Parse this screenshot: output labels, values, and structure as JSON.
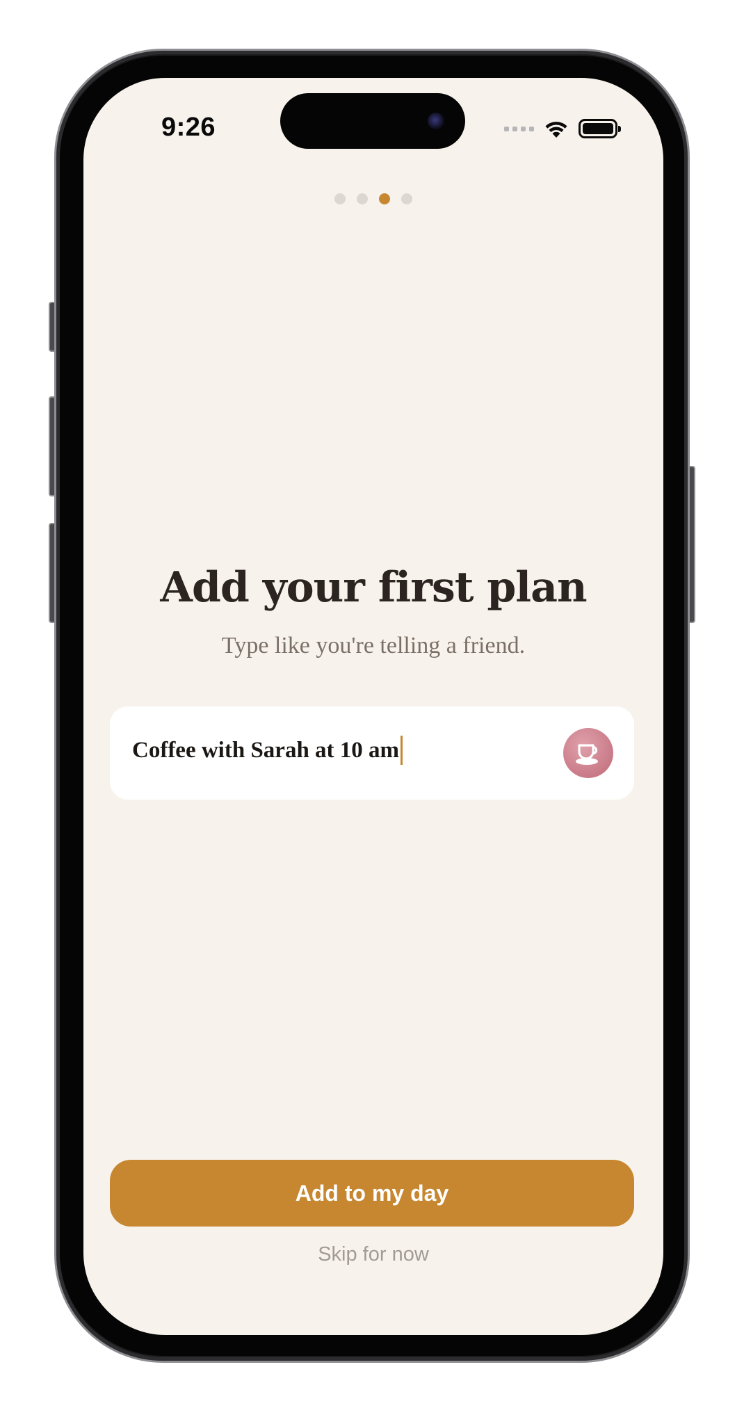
{
  "status_bar": {
    "time": "9:26",
    "icons": [
      "cellular-signal-icon",
      "wifi-icon",
      "battery-icon"
    ]
  },
  "pager": {
    "total": 4,
    "active_index": 2
  },
  "onboarding": {
    "title": "Add your first plan",
    "subtitle": "Type like you're telling a friend.",
    "plan_input": {
      "value": "Coffee with Sarah at 10 am",
      "icon": "coffee-cup-icon"
    },
    "primary_button_label": "Add to my day",
    "skip_label": "Skip for now"
  },
  "colors": {
    "background": "#f7f3ec",
    "accent": "#c78731",
    "title_text": "#2b2420",
    "subtitle_text": "#7a6f66",
    "coffee_badge": "#c97a87",
    "inactive_dot": "#dcd7cf"
  }
}
